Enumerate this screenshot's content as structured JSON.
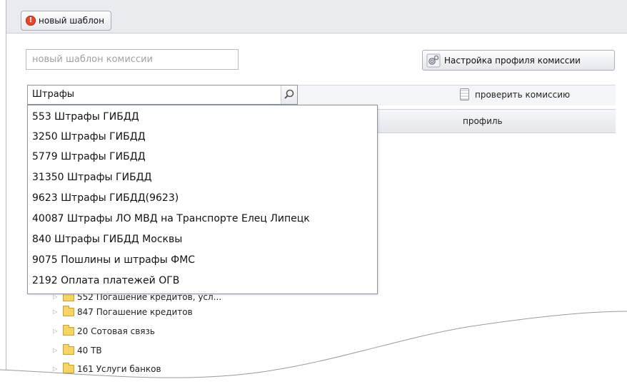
{
  "tab": {
    "label": "новый шаблон",
    "icon": "alert-icon",
    "color": "#e24a2c"
  },
  "template_name": {
    "placeholder": "новый шаблон комиссии",
    "value": ""
  },
  "profile_button": {
    "label": "Настройка профиля комиссии",
    "icon": "gear-icon"
  },
  "search": {
    "value": "Штрафы",
    "icon": "search-icon"
  },
  "check_button": {
    "label": "проверить комиссию",
    "icon": "calculator-icon"
  },
  "columns": {
    "profile": "профиль"
  },
  "dropdown": {
    "items": [
      "553  Штрафы ГИБДД",
      "3250  Штрафы ГИБДД",
      "5779  Штрафы ГИБДД",
      "31350  Штрафы ГИБДД",
      "9623  Штрафы ГИБДД(9623)",
      "40087  Штрафы ЛО МВД на Транспорте Елец Липецк",
      "840  Штрафы ГИБДД Москвы",
      "9075  Пошлины и штрафы ФМС",
      "2192  Оплата платежей ОГВ"
    ]
  },
  "tree": {
    "items": [
      "552 Погашение кредитов, усл...",
      "847 Погашение кредитов",
      "20 Сотовая связь",
      "40 ТВ",
      "161 Услуги банков"
    ]
  }
}
